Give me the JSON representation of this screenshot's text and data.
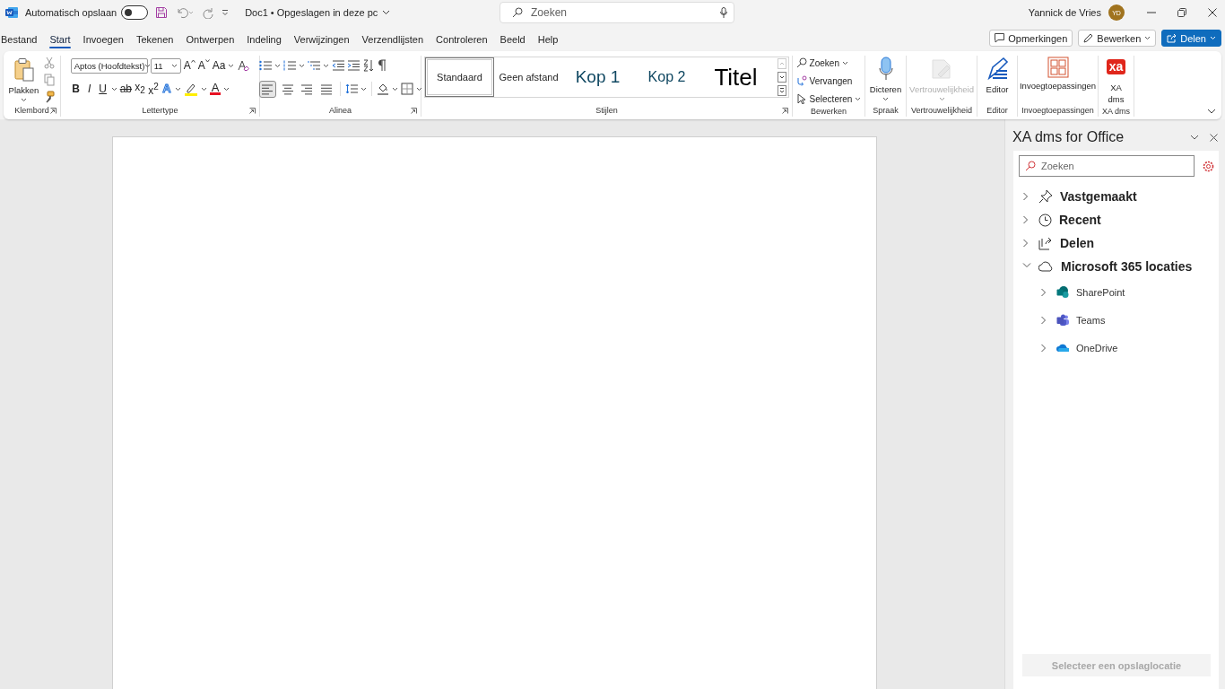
{
  "titlebar": {
    "autosave_label": "Automatisch opslaan",
    "autosave_on": false,
    "document_title": "Doc1 • Opgeslagen in deze pc",
    "search_placeholder": "Zoeken",
    "user_name": "Yannick de Vries",
    "user_initials": "YD"
  },
  "menu_tabs": [
    {
      "label": "Bestand",
      "selected": false
    },
    {
      "label": "Start",
      "selected": true
    },
    {
      "label": "Invoegen",
      "selected": false
    },
    {
      "label": "Tekenen",
      "selected": false
    },
    {
      "label": "Ontwerpen",
      "selected": false
    },
    {
      "label": "Indeling",
      "selected": false
    },
    {
      "label": "Verwijzingen",
      "selected": false
    },
    {
      "label": "Verzendlijsten",
      "selected": false
    },
    {
      "label": "Controleren",
      "selected": false
    },
    {
      "label": "Beeld",
      "selected": false
    },
    {
      "label": "Help",
      "selected": false
    }
  ],
  "header_actions": [
    {
      "kind": "comments",
      "label": "Opmerkingen"
    },
    {
      "kind": "edit",
      "label": "Bewerken"
    },
    {
      "kind": "share",
      "label": "Delen"
    }
  ],
  "ribbon": {
    "groups": [
      {
        "kind": "clipboard",
        "label": "Klembord",
        "launcher": true,
        "paste_label": "Plakken"
      },
      {
        "kind": "font",
        "label": "Lettertype",
        "launcher": true,
        "font_name": "Aptos (Hoofdtekst)",
        "font_size": "11",
        "size_buttons": [
          {
            "kind": "grow",
            "text": "A"
          },
          {
            "kind": "shrink",
            "text": "A"
          },
          {
            "kind": "case",
            "text": "Aa"
          }
        ],
        "format_buttons": [
          {
            "kind": "bold",
            "text": "B"
          },
          {
            "kind": "italic",
            "text": "I"
          },
          {
            "kind": "underline",
            "text": "U"
          },
          {
            "kind": "strike",
            "text": "ab"
          },
          {
            "kind": "subscript",
            "text": "x$_{2}$"
          },
          {
            "kind": "superscript",
            "text": "x$^{2}$"
          },
          {
            "kind": "effects",
            "text": "A"
          },
          {
            "kind": "highlight"
          },
          {
            "kind": "color",
            "text": "A"
          }
        ]
      },
      {
        "kind": "paragraph",
        "label": "Alinea",
        "launcher": true,
        "alignment": [
          {
            "kind": "left",
            "selected": true
          },
          {
            "kind": "center",
            "selected": false
          },
          {
            "kind": "right",
            "selected": false
          },
          {
            "kind": "justify",
            "selected": false
          }
        ]
      },
      {
        "kind": "styles",
        "label": "Stijlen",
        "launcher": true,
        "styles": [
          {
            "kind": "normal",
            "label": "Standaard",
            "selected": true
          },
          {
            "kind": "no-spacing",
            "label": "Geen afstand",
            "selected": false
          },
          {
            "kind": "heading1",
            "label": "Kop 1",
            "selected": false
          },
          {
            "kind": "heading2",
            "label": "Kop 2",
            "selected": false
          },
          {
            "kind": "title",
            "label": "Titel",
            "selected": false
          }
        ]
      },
      {
        "kind": "editing",
        "label": "Bewerken",
        "launcher": false,
        "commands": [
          {
            "kind": "find",
            "label": "Zoeken"
          },
          {
            "kind": "replace",
            "label": "Vervangen"
          },
          {
            "kind": "select",
            "label": "Selecteren"
          }
        ]
      },
      {
        "kind": "voice",
        "label": "Spraak",
        "launcher": false,
        "button_label": "Dicteren",
        "disabled": false
      },
      {
        "kind": "sensitivity",
        "label": "Vertrouwelijkheid",
        "launcher": false,
        "button_label": "Vertrouwelijkheid",
        "disabled": true
      },
      {
        "kind": "editor",
        "label": "Editor",
        "launcher": false,
        "button_label": "Editor",
        "disabled": false
      },
      {
        "kind": "addins",
        "label": "Invoegtoepassingen",
        "launcher": false,
        "button_label": "Invoegtoepassingen",
        "disabled": false
      },
      {
        "kind": "xadms",
        "label": "XA dms",
        "launcher": false,
        "button_label": "XA dms",
        "icon_text": "xa",
        "disabled": false
      }
    ]
  },
  "task_pane": {
    "title": "XA dms for Office",
    "search_placeholder": "Zoeken",
    "tree": [
      {
        "kind": "pinned",
        "label": "Vastgemaakt",
        "expanded": false
      },
      {
        "kind": "recent",
        "label": "Recent",
        "expanded": false
      },
      {
        "kind": "shared",
        "label": "Delen",
        "expanded": false
      },
      {
        "kind": "cloud",
        "label": "Microsoft 365 locaties",
        "expanded": true,
        "children": [
          {
            "kind": "sharepoint",
            "label": "SharePoint",
            "expanded": false
          },
          {
            "kind": "teams",
            "label": "Teams",
            "expanded": false
          },
          {
            "kind": "onedrive",
            "label": "OneDrive",
            "expanded": false
          }
        ]
      }
    ],
    "footer_button": {
      "label": "Selecteer een opslaglocatie",
      "disabled": true
    }
  }
}
